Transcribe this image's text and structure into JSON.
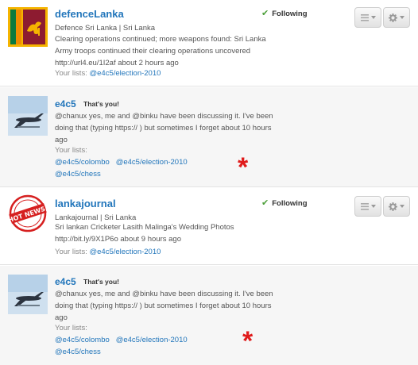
{
  "cards": [
    {
      "name": "defenceLanka",
      "meta": "Defence Sri Lanka | Sri Lanka",
      "tweet": "Clearing operations continued; more weapons found: Sri Lanka Army troops continued their clearing operations uncovered http://url4.eu/1I2af  about 2 hours ago",
      "lists_label": "Your lists:",
      "lists": [
        "@e4c5/election-2010"
      ],
      "following": "Following"
    },
    {
      "name": "e4c5",
      "badge": "That's you!",
      "tweet": "@chanux yes, me and @binku have been discussing it. I've been doing that (typing https:// ) but sometimes I forget  about 10 hours ago",
      "lists_label": "Your lists:",
      "lists": [
        "@e4c5/colombo",
        "@e4c5/election-2010",
        "@e4c5/chess"
      ],
      "annotation": "*"
    },
    {
      "name": "lankajournal",
      "meta": "Lankajournal | Sri Lanka",
      "tweet": "Sri lankan Cricketer Lasith Malinga's Wedding Photos http://bit.ly/9X1P6o  about 9 hours ago",
      "lists_label": "Your lists:",
      "lists": [
        "@e4c5/election-2010"
      ],
      "following": "Following"
    },
    {
      "name": "e4c5",
      "badge": "That's you!",
      "tweet": "@chanux yes, me and @binku have been discussing it. I've been doing that (typing https:// ) but sometimes I forget  about 10 hours ago",
      "lists_label": "Your lists:",
      "lists": [
        "@e4c5/colombo",
        "@e4c5/election-2010",
        "@e4c5/chess"
      ],
      "annotation": "*"
    }
  ],
  "logo_text": "HOT NEWS!",
  "icons": {
    "following": "checkmark-icon",
    "list_menu": "list-icon",
    "actions_menu": "gear-icon"
  },
  "colors": {
    "link": "#2276bb",
    "check": "#4c9f3a",
    "annotation": "#e01b1b"
  }
}
